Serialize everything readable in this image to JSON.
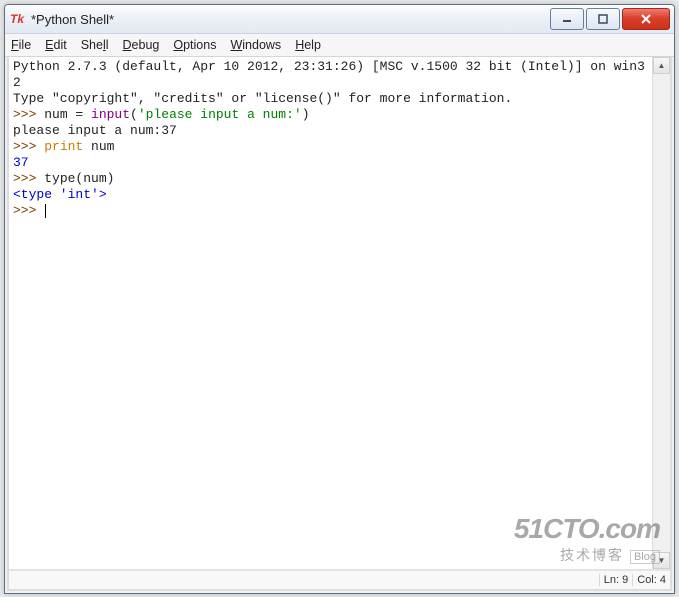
{
  "window": {
    "title": "*Python Shell*",
    "icon_label": "Tk"
  },
  "menu": {
    "file": "File",
    "edit": "Edit",
    "shell": "Shell",
    "debug": "Debug",
    "options": "Options",
    "windows": "Windows",
    "help": "Help"
  },
  "shell": {
    "banner1": "Python 2.7.3 (default, Apr 10 2012, 23:31:26) [MSC v.1500 32 bit (Intel)] on win32",
    "banner2": "Type \"copyright\", \"credits\" or \"license()\" for more information.",
    "prompt": ">>> ",
    "line1_pre": "num = ",
    "line1_func": "input",
    "line1_paren_open": "(",
    "line1_str": "'please input a num:'",
    "line1_paren_close": ")",
    "line2_out": "please input a num:",
    "line2_in": "37",
    "line3_kw": "print",
    "line3_rest": " num",
    "line4_out": "37",
    "line5_code": "type(num)",
    "line6_out": "<type 'int'>"
  },
  "status": {
    "ln_label": "Ln: ",
    "ln_value": "9",
    "col_label": "Col: ",
    "col_value": "4"
  },
  "watermark": {
    "line1": "51CTO.com",
    "line2": "技术博客",
    "line2_tag": "Blog"
  }
}
